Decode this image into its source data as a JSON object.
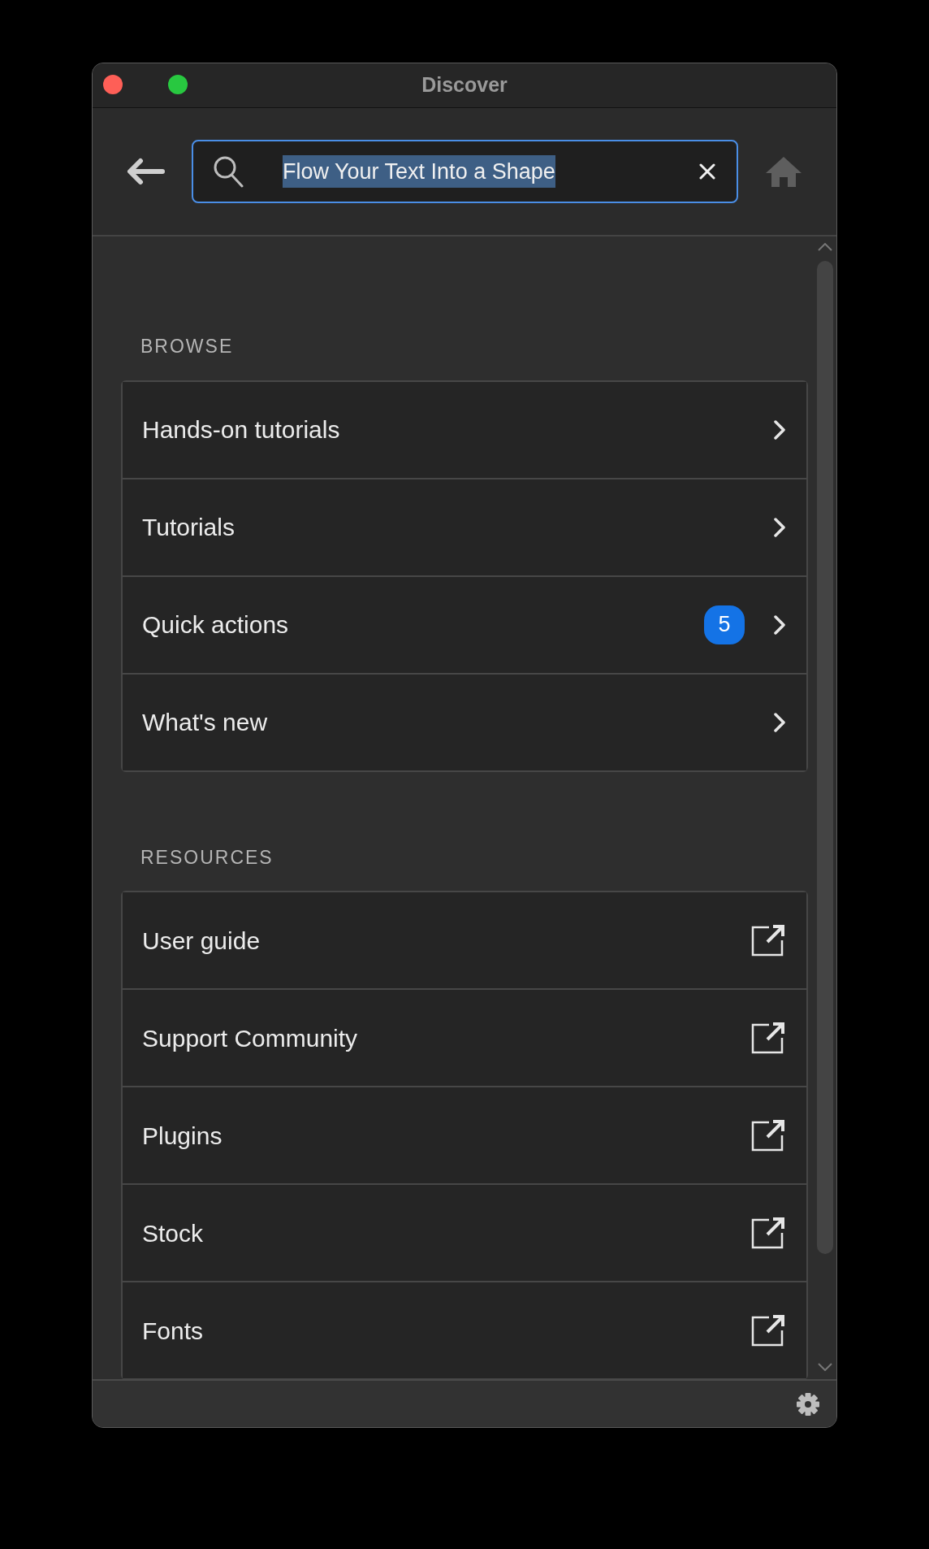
{
  "window": {
    "title": "Discover"
  },
  "search": {
    "value": "Flow Your Text Into a Shape",
    "text_selected": true
  },
  "home_button": {
    "disabled": true
  },
  "sections": [
    {
      "title": "BROWSE",
      "items": [
        {
          "label": "Hands-on tutorials",
          "kind": "internal"
        },
        {
          "label": "Tutorials",
          "kind": "internal"
        },
        {
          "label": "Quick actions",
          "kind": "internal",
          "badge": "5"
        },
        {
          "label": "What's new",
          "kind": "internal"
        }
      ]
    },
    {
      "title": "RESOURCES",
      "items": [
        {
          "label": "User guide",
          "kind": "external"
        },
        {
          "label": "Support Community",
          "kind": "external"
        },
        {
          "label": "Plugins",
          "kind": "external"
        },
        {
          "label": "Stock",
          "kind": "external"
        },
        {
          "label": "Fonts",
          "kind": "external"
        }
      ]
    }
  ]
}
